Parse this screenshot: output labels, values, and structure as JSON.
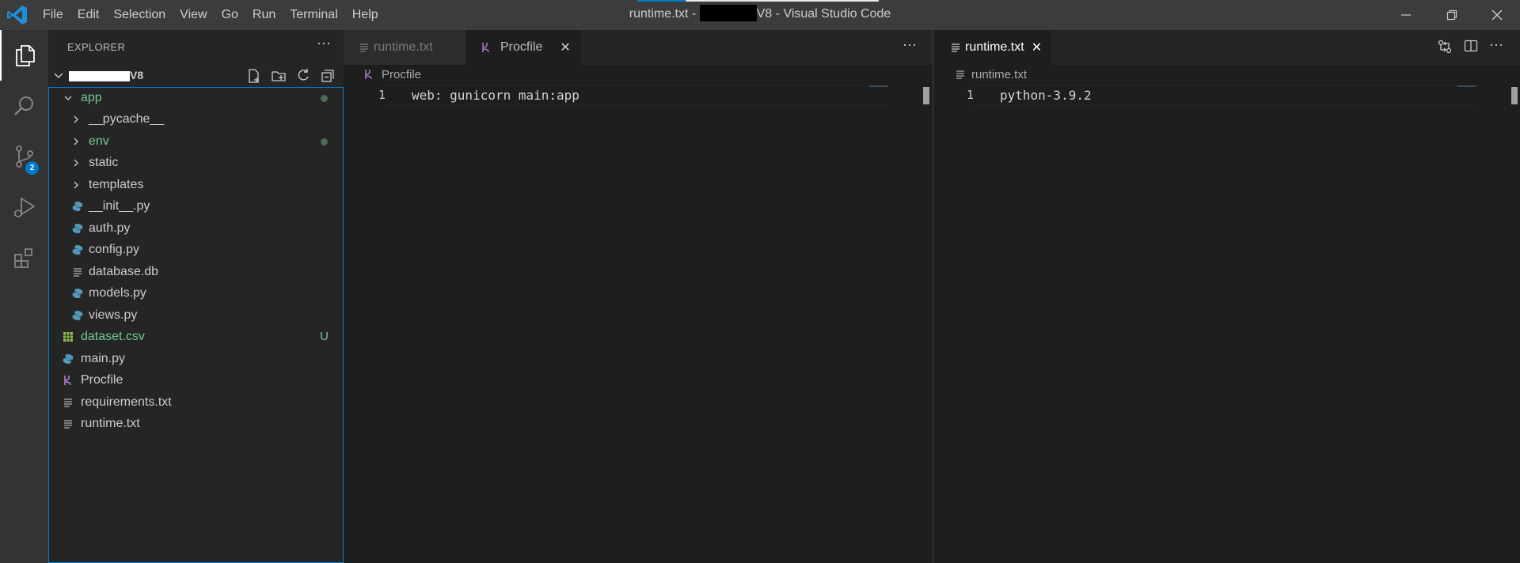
{
  "menu": [
    "File",
    "Edit",
    "Selection",
    "View",
    "Go",
    "Run",
    "Terminal",
    "Help"
  ],
  "window_title": {
    "prefix": "runtime.txt - ",
    "suffix": "V8 - Visual Studio Code"
  },
  "sidebar": {
    "title": "EXPLORER",
    "more": "···",
    "workspace_suffix": "V8",
    "tree": [
      {
        "label": "app",
        "type": "folder-open",
        "indent": 0,
        "modified_dot": true,
        "green": true
      },
      {
        "label": "__pycache__",
        "type": "folder",
        "indent": 1
      },
      {
        "label": "env",
        "type": "folder",
        "indent": 1,
        "modified_dot": true,
        "green": true
      },
      {
        "label": "static",
        "type": "folder",
        "indent": 1
      },
      {
        "label": "templates",
        "type": "folder",
        "indent": 1
      },
      {
        "label": "__init__.py",
        "type": "python",
        "indent": 1
      },
      {
        "label": "auth.py",
        "type": "python",
        "indent": 1
      },
      {
        "label": "config.py",
        "type": "python",
        "indent": 1
      },
      {
        "label": "database.db",
        "type": "text",
        "indent": 1
      },
      {
        "label": "models.py",
        "type": "python",
        "indent": 1
      },
      {
        "label": "views.py",
        "type": "python",
        "indent": 1
      },
      {
        "label": "dataset.csv",
        "type": "csv",
        "indent": 0,
        "status": "U",
        "green": true
      },
      {
        "label": "main.py",
        "type": "python",
        "indent": 0
      },
      {
        "label": "Procfile",
        "type": "procfile",
        "indent": 0
      },
      {
        "label": "requirements.txt",
        "type": "text",
        "indent": 0
      },
      {
        "label": "runtime.txt",
        "type": "text",
        "indent": 0
      }
    ]
  },
  "activity": {
    "scm_badge": "2"
  },
  "editor_left": {
    "tabs": [
      {
        "label": "runtime.txt",
        "active": false
      },
      {
        "label": "Procfile",
        "active": true
      }
    ],
    "tab_close": "✕",
    "more": "···",
    "breadcrumb": "Procfile",
    "line_number": "1",
    "code": "web: gunicorn main:app"
  },
  "editor_right": {
    "tabs": [
      {
        "label": "runtime.txt",
        "active": true
      }
    ],
    "tab_close": "✕",
    "more": "···",
    "breadcrumb": "runtime.txt",
    "line_number": "1",
    "code": "python-3.9.2"
  },
  "colors": {
    "accent": "#007acc",
    "git_added": "#73c991",
    "python_icon": "#519aba",
    "procfile_icon": "#a074c4",
    "csv_icon": "#8dc149"
  }
}
